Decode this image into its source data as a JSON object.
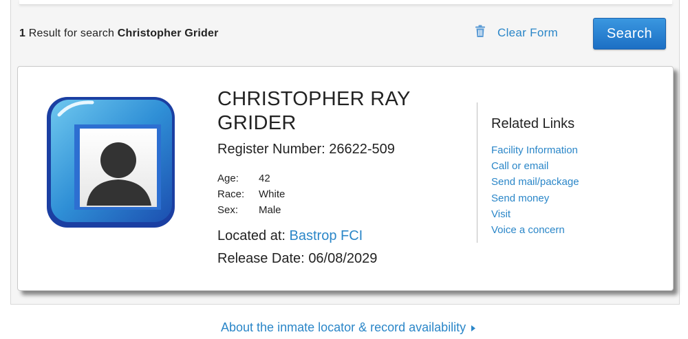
{
  "results": {
    "count": "1",
    "text": "Result for search",
    "query": "Christopher Grider"
  },
  "toolbar": {
    "clear_form_label": "Clear Form",
    "search_label": "Search"
  },
  "inmate": {
    "name": "CHRISTOPHER RAY GRIDER",
    "register_label": "Register Number:",
    "register_number": "26622-509",
    "facts": [
      {
        "label": "Age:",
        "value": "42"
      },
      {
        "label": "Race:",
        "value": "White"
      },
      {
        "label": "Sex:",
        "value": "Male"
      }
    ],
    "located_label": "Located at:",
    "facility": "Bastrop FCI",
    "release_label": "Release Date:",
    "release_date": "06/08/2029"
  },
  "related": {
    "title": "Related Links",
    "links": [
      "Facility Information",
      "Call or email",
      "Send mail/package",
      "Send money",
      "Visit",
      "Voice a concern"
    ]
  },
  "footer": {
    "about_label": "About the inmate locator & record availability"
  },
  "colors": {
    "link": "#2a86c8",
    "button": "#1f77c9"
  },
  "icons": {
    "trash": "trash-icon",
    "photo": "profile-placeholder-icon",
    "arrow": "caret-right-icon"
  }
}
